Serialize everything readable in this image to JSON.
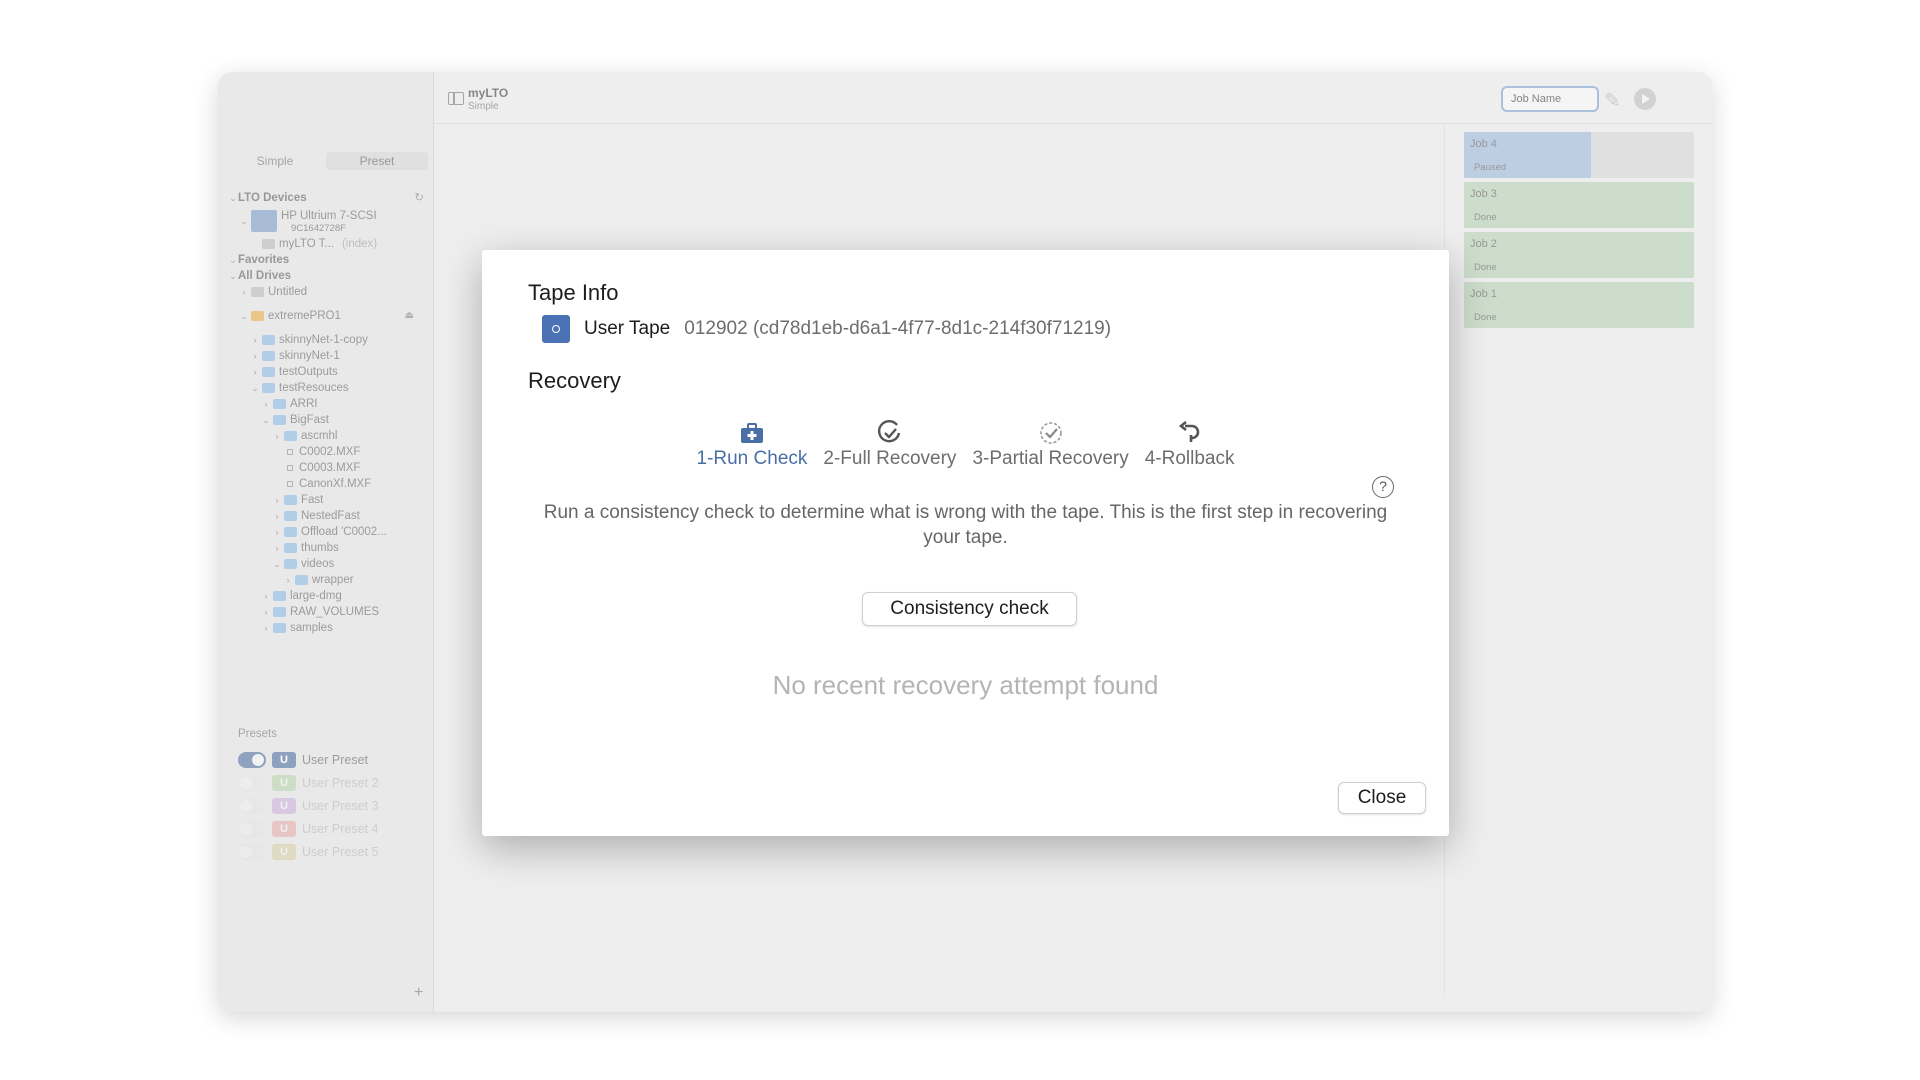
{
  "sidebar": {
    "segments": [
      "Simple",
      "Preset"
    ],
    "tree": [
      {
        "type": "section",
        "label": "LTO Devices",
        "indent": 0,
        "chevron": "v"
      },
      {
        "type": "device",
        "label": "HP Ultrium 7-SCSI",
        "sub": "9C1642728F",
        "indent": 1,
        "chevron": "v"
      },
      {
        "type": "tape",
        "label": "myLTO T...",
        "extra": "(index)",
        "indent": 2
      },
      {
        "type": "section",
        "label": "Favorites",
        "indent": 0,
        "chevron": "v"
      },
      {
        "type": "section",
        "label": "All Drives",
        "indent": 0,
        "chevron": "v"
      },
      {
        "type": "drive",
        "label": "Untitled",
        "indent": 1,
        "chevron": ">"
      },
      {
        "type": "drive-ext",
        "label": "extremePRO1",
        "indent": 1,
        "chevron": "v"
      },
      {
        "type": "folder",
        "label": "skinnyNet-1-copy",
        "indent": 2,
        "chevron": ">"
      },
      {
        "type": "folder",
        "label": "skinnyNet-1",
        "indent": 2,
        "chevron": ">"
      },
      {
        "type": "folder",
        "label": "testOutputs",
        "indent": 2,
        "chevron": ">"
      },
      {
        "type": "folder",
        "label": "testResouces",
        "indent": 2,
        "chevron": "v"
      },
      {
        "type": "folder",
        "label": "ARRI",
        "indent": 3,
        "chevron": ">"
      },
      {
        "type": "folder",
        "label": "BigFast",
        "indent": 3,
        "chevron": "v"
      },
      {
        "type": "folder",
        "label": "ascmhl",
        "indent": 4,
        "chevron": ">"
      },
      {
        "type": "file",
        "label": "C0002.MXF",
        "indent": 4
      },
      {
        "type": "file",
        "label": "C0003.MXF",
        "indent": 4
      },
      {
        "type": "file",
        "label": "CanonXf.MXF",
        "indent": 4
      },
      {
        "type": "folder",
        "label": "Fast",
        "indent": 4,
        "chevron": ">"
      },
      {
        "type": "folder",
        "label": "NestedFast",
        "indent": 4,
        "chevron": ">"
      },
      {
        "type": "folder",
        "label": "Offload 'C0002...",
        "indent": 4,
        "chevron": ">"
      },
      {
        "type": "folder",
        "label": "thumbs",
        "indent": 4,
        "chevron": ">"
      },
      {
        "type": "folder",
        "label": "videos",
        "indent": 4,
        "chevron": "v"
      },
      {
        "type": "folder",
        "label": "wrapper",
        "indent": 5,
        "chevron": ">"
      },
      {
        "type": "folder",
        "label": "large-dmg",
        "indent": 3,
        "chevron": ">"
      },
      {
        "type": "folder",
        "label": "RAW_VOLUMES",
        "indent": 3,
        "chevron": ">"
      },
      {
        "type": "folder",
        "label": "samples",
        "indent": 3,
        "chevron": ">"
      }
    ],
    "presets_header": "Presets",
    "presets": [
      {
        "label": "User Preset",
        "badge": "U",
        "color": "#7f95b5",
        "on": true
      },
      {
        "label": "User Preset 2",
        "badge": "U",
        "color": "#8cc47a",
        "on": false
      },
      {
        "label": "User Preset 3",
        "badge": "U",
        "color": "#b27fd0",
        "on": false
      },
      {
        "label": "User Preset 4",
        "badge": "U",
        "color": "#e27777",
        "on": false
      },
      {
        "label": "User Preset 5",
        "badge": "U",
        "color": "#c9b86b",
        "on": false
      }
    ],
    "add_label": "+"
  },
  "toolbar": {
    "title": "myLTO",
    "subtitle": "Simple",
    "job_name_placeholder": "Job Name"
  },
  "jobs": [
    {
      "name": "Job 4",
      "status": "Paused",
      "progress": 0.55
    },
    {
      "name": "Job 3",
      "status": "Done",
      "progress": 1
    },
    {
      "name": "Job 2",
      "status": "Done",
      "progress": 1
    },
    {
      "name": "Job 1",
      "status": "Done",
      "progress": 1
    }
  ],
  "modal": {
    "tape_info_title": "Tape Info",
    "tape_label": "User Tape",
    "tape_id": "012902 (cd78d1eb-d6a1-4f77-8d1c-214f30f71219)",
    "recovery_title": "Recovery",
    "tabs": [
      {
        "label": "1-Run Check",
        "icon": "first-aid-kit-icon",
        "active": true
      },
      {
        "label": "2-Full Recovery",
        "icon": "check-circle-icon",
        "active": false
      },
      {
        "label": "3-Partial Recovery",
        "icon": "partial-check-circle-icon",
        "active": false
      },
      {
        "label": "4-Rollback",
        "icon": "rollback-arrow-icon",
        "active": false
      }
    ],
    "help": "?",
    "description": "Run a consistency check to determine what is wrong with the tape. This is the first step in recovering your tape.",
    "action_button": "Consistency check",
    "empty_state": "No recent recovery attempt found",
    "close_button": "Close"
  },
  "colors": {
    "accent": "#4a6fa5",
    "tape_icon": "#4a72b4",
    "job_done": "#c7d9c4",
    "job_paused": "#b6c8de"
  }
}
